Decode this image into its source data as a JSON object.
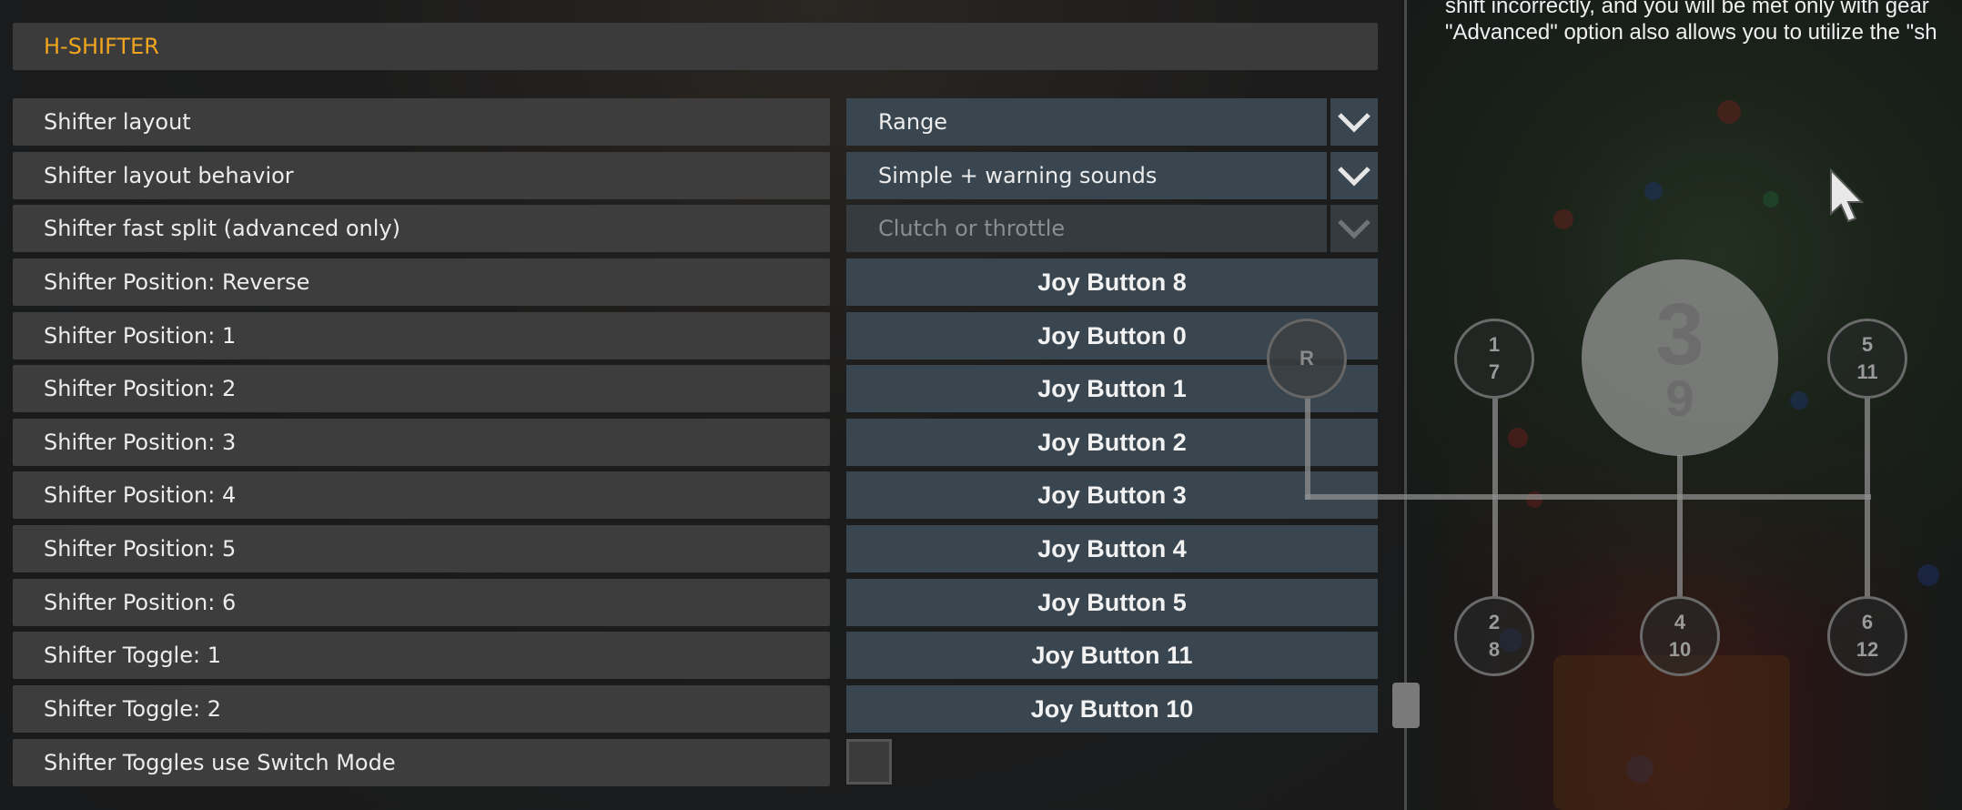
{
  "section": {
    "title": "H-SHIFTER"
  },
  "description": {
    "line1": "shift incorrectly, and you will be met only with gear",
    "line2": "\"Advanced\" option also allows you to utilize the \"sh"
  },
  "settings": [
    {
      "label": "Shifter layout",
      "type": "select",
      "value": "Range",
      "disabled": false
    },
    {
      "label": "Shifter layout behavior",
      "type": "select",
      "value": "Simple + warning sounds",
      "disabled": false
    },
    {
      "label": "Shifter fast split (advanced only)",
      "type": "select",
      "value": "Clutch or throttle",
      "disabled": true
    },
    {
      "label": "Shifter Position: Reverse",
      "type": "binding",
      "value": "Joy Button 8"
    },
    {
      "label": "Shifter Position: 1",
      "type": "binding",
      "value": "Joy Button 0"
    },
    {
      "label": "Shifter Position: 2",
      "type": "binding",
      "value": "Joy Button 1"
    },
    {
      "label": "Shifter Position: 3",
      "type": "binding",
      "value": "Joy Button 2"
    },
    {
      "label": "Shifter Position: 4",
      "type": "binding",
      "value": "Joy Button 3"
    },
    {
      "label": "Shifter Position: 5",
      "type": "binding",
      "value": "Joy Button 4"
    },
    {
      "label": "Shifter Position: 6",
      "type": "binding",
      "value": "Joy Button 5"
    },
    {
      "label": "Shifter Toggle: 1",
      "type": "binding",
      "value": "Joy Button 11"
    },
    {
      "label": "Shifter Toggle: 2",
      "type": "binding",
      "value": "Joy Button 10"
    },
    {
      "label": "Shifter Toggles use Switch Mode",
      "type": "checkbox",
      "checked": false
    }
  ],
  "diagram": {
    "reverse": "R",
    "gear_1": {
      "top": "1",
      "bottom": "7"
    },
    "gear_3": {
      "top": "3",
      "bottom": "9"
    },
    "gear_5": {
      "top": "5",
      "bottom": "11"
    },
    "gear_2": {
      "top": "2",
      "bottom": "8"
    },
    "gear_4": {
      "top": "4",
      "bottom": "10"
    },
    "gear_6": {
      "top": "6",
      "bottom": "12"
    },
    "active_gear": "3"
  },
  "icons": {
    "dropdown": "chevron-down-icon",
    "pointer": "mouse-cursor-icon"
  },
  "colors": {
    "accent": "#f2a51f",
    "control_bg": "#394650",
    "row_bg": "#3d3d3d"
  }
}
